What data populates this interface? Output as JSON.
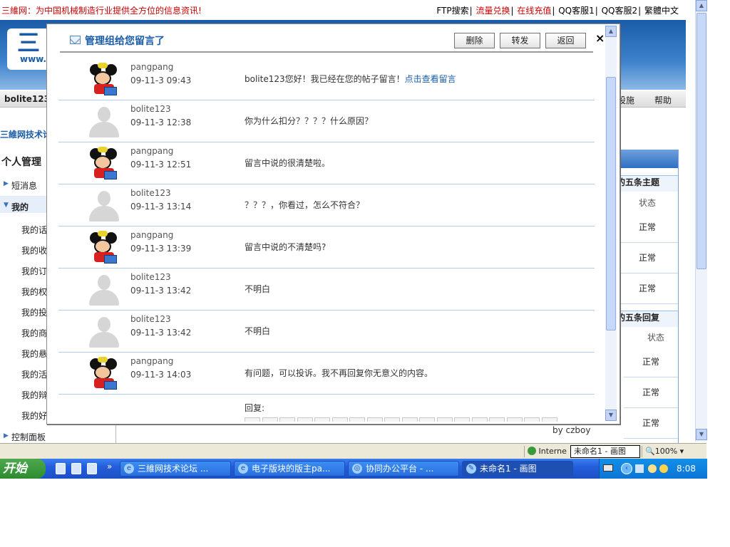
{
  "topbar": {
    "slogan": "三維网：为中国机械制造行业提供全方位的信息资讯!",
    "links": [
      "FTP搜索",
      "流量兑换",
      "在线充值",
      "QQ客服1",
      "QQ客服2",
      "繁體中文"
    ]
  },
  "banner": {
    "logo_text": "三",
    "logo_sub": "www."
  },
  "navbar": {
    "user": "bolite123",
    "right_item": "设施",
    "help": "帮助"
  },
  "breadcrumb": "三維网技术论",
  "sidebar": {
    "title": "个人管理",
    "items": [
      "短消息",
      "我的"
    ],
    "subitems": [
      "我的话",
      "我的收",
      "我的订",
      "我的权",
      "我的投",
      "我的商",
      "我的悬",
      "我的活",
      "我的辩",
      "我的好"
    ],
    "footer_item": "控制面板"
  },
  "rpanel": {
    "section1": "的五条主题",
    "section2": "的五条回复",
    "status_header": "状态",
    "cells1": [
      "正常",
      "正常",
      "正常"
    ],
    "cells2": [
      "正常",
      "正常",
      "正常"
    ],
    "byline": "by czboy"
  },
  "modal": {
    "title": "管理组给您留言了",
    "buttons": {
      "delete": "删除",
      "forward": "转发",
      "back": "返回"
    },
    "close": "×",
    "messages": [
      {
        "author": "pangpang",
        "time": "09-11-3 09:43",
        "content": "bolite123您好！我已经在您的帖子留言！",
        "link": "点击查看留言",
        "avatar": "mouse"
      },
      {
        "author": "bolite123",
        "time": "09-11-3 12:38",
        "content": "你为什么扣分？？？？什么原因？",
        "avatar": "user"
      },
      {
        "author": "pangpang",
        "time": "09-11-3 12:51",
        "content": "留言中说的很清楚啦。",
        "avatar": "mouse"
      },
      {
        "author": "bolite123",
        "time": "09-11-3 13:14",
        "content": "？？？，你看过，怎么不符合？",
        "avatar": "user"
      },
      {
        "author": "pangpang",
        "time": "09-11-3 13:39",
        "content": "留言中说的不清楚吗?",
        "avatar": "mouse"
      },
      {
        "author": "bolite123",
        "time": "09-11-3 13:42",
        "content": "不明白",
        "avatar": "user"
      },
      {
        "author": "bolite123",
        "time": "09-11-3 13:42",
        "content": "不明白",
        "avatar": "user"
      },
      {
        "author": "pangpang",
        "time": "09-11-3 14:03",
        "content": "有问题，可以投诉。我不再回复你无意义的内容。",
        "avatar": "mouse"
      }
    ],
    "reply_label": "回复:"
  },
  "statusbar": {
    "zone": "Interne",
    "paint_title": "未命名1 - 画图",
    "zoom": "100%"
  },
  "taskbar": {
    "start": "开始",
    "windows": [
      "三維网技术论坛 ...",
      "电子版块的版主pa...",
      "协同办公平台 - ...",
      "未命名1 - 画图"
    ],
    "clock": "8:08"
  }
}
